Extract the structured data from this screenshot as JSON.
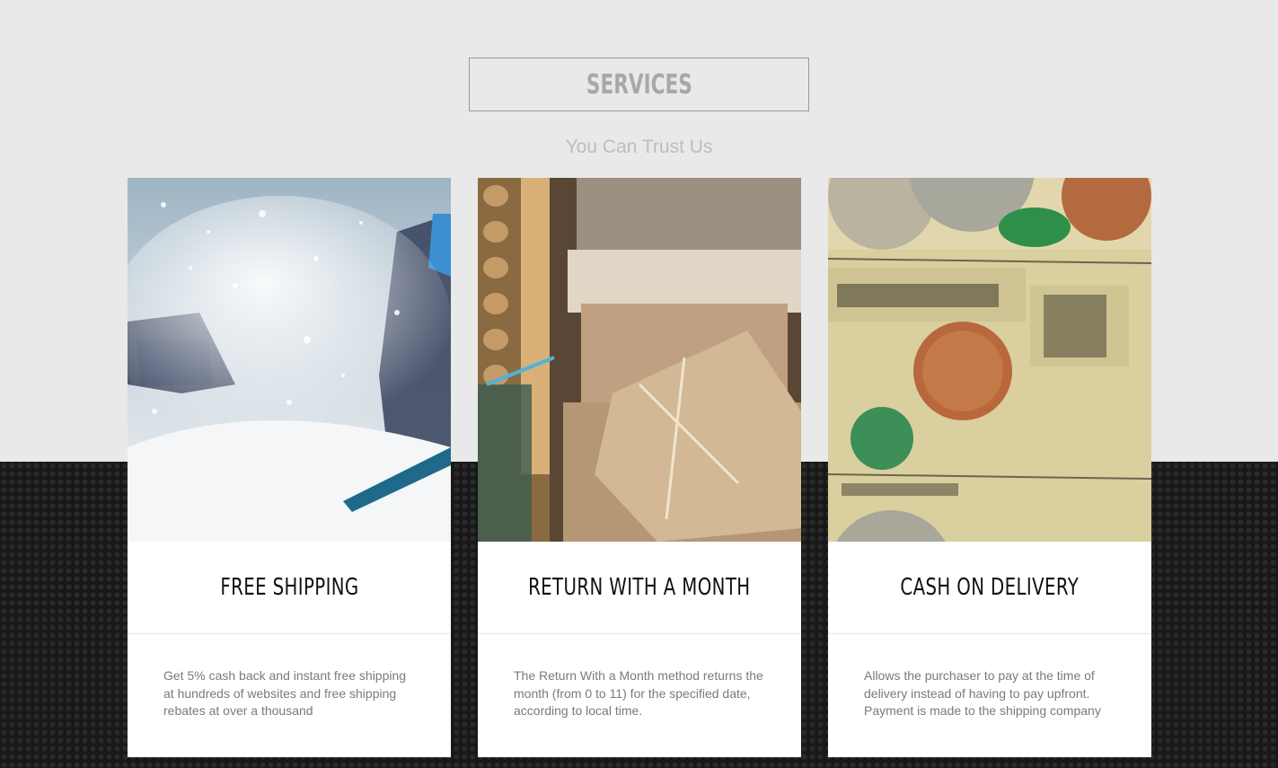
{
  "section": {
    "title": "SERVICES",
    "subtitle": "You Can Trust Us"
  },
  "cards": [
    {
      "image_name": "snowboarder-photo",
      "title": "FREE SHIPPING",
      "text": "Get 5% cash back and instant free shipping at hundreds of websites and free shipping rebates at over a thousand"
    },
    {
      "image_name": "packages-photo",
      "title": "RETURN WITH A MONTH",
      "text": "The Return With a Month method returns the month (from 0 to 11) for the specified date, according to local time."
    },
    {
      "image_name": "money-photo",
      "title": "CASH ON DELIVERY",
      "text": "Allows the purchaser to pay at the time of delivery instead of having to pay upfront. Payment is made to the shipping company"
    }
  ],
  "colors": {
    "top_background": "#e9e9e9",
    "bottom_background": "#181818",
    "card_background": "#ffffff",
    "title_color": "#a8a8a8"
  }
}
